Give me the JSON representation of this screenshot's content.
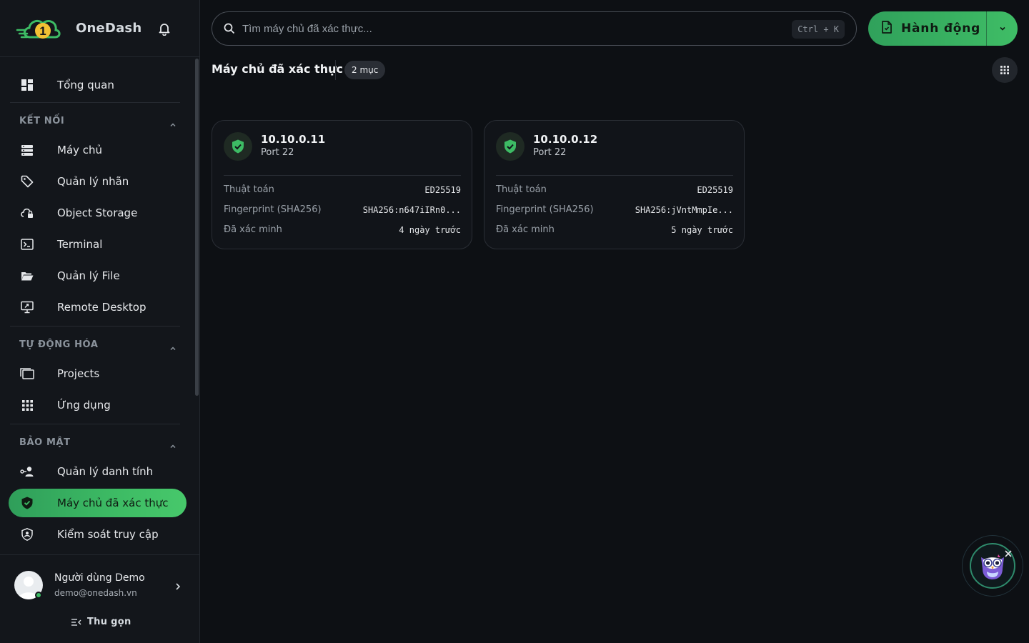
{
  "brand": {
    "name": "OneDash",
    "logo_letter": "1"
  },
  "search": {
    "placeholder": "Tìm máy chủ đã xác thực...",
    "shortcut": "Ctrl + K"
  },
  "action_button": {
    "label": "Hành động"
  },
  "nav": {
    "overview": "Tổng quan",
    "sections": [
      {
        "title": "KẾT NỐI",
        "items": [
          "Máy chủ",
          "Quản lý nhãn",
          "Object Storage",
          "Terminal",
          "Quản lý File",
          "Remote Desktop"
        ]
      },
      {
        "title": "TỰ ĐỘNG HÓA",
        "items": [
          "Projects",
          "Ứng dụng"
        ]
      },
      {
        "title": "BẢO MẬT",
        "items": [
          "Quản lý danh tính",
          "Máy chủ đã xác thực",
          "Kiểm soát truy cập"
        ]
      }
    ],
    "active": "Máy chủ đã xác thực"
  },
  "user": {
    "name": "Người dùng Demo",
    "email": "demo@onedash.vn",
    "status": "online"
  },
  "collapse_label": "Thu gọn",
  "page": {
    "title": "Máy chủ đã xác thực",
    "count": "2 mục"
  },
  "cards": [
    {
      "ip": "10.10.0.11",
      "port": "Port 22",
      "rows": [
        {
          "key": "Thuật toán",
          "value": "ED25519"
        },
        {
          "key": "Fingerprint (SHA256)",
          "value": "SHA256:n647iIRn0..."
        },
        {
          "key": "Đã xác minh",
          "value": "4 ngày trước"
        }
      ]
    },
    {
      "ip": "10.10.0.12",
      "port": "Port 22",
      "rows": [
        {
          "key": "Thuật toán",
          "value": "ED25519"
        },
        {
          "key": "Fingerprint (SHA256)",
          "value": "SHA256:jVntMmpIe..."
        },
        {
          "key": "Đã xác minh",
          "value": "5 ngày trước"
        }
      ]
    }
  ],
  "colors": {
    "accent": "#3dbb64",
    "background": "#0d1014",
    "sidebar": "#13161b"
  }
}
